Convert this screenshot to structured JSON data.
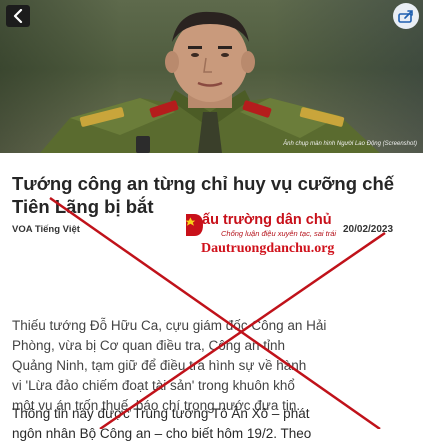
{
  "hero": {
    "caption": "Ảnh chụp màn hình Người Lao Động (Screenshot)"
  },
  "header": {
    "back_icon": "chevron-left-icon",
    "share_icon": "share-icon"
  },
  "article": {
    "headline_line1": "Tướng công an từng chỉ huy vụ cưỡng chế",
    "headline_line2": "Tiên Lãng bị bắt",
    "source": "VOA Tiếng Việt",
    "date": "20/02/2023",
    "para1_lines": [
      "Thiếu tướng Đỗ Hữu Ca, cựu giám đốc Công an Hải",
      "Phòng, vừa bị Cơ quan điều tra, Công an tỉnh",
      "Quảng Ninh, tạm giữ để điều tra hình sự về hành",
      "vi 'Lừa đảo chiếm đoạt tài sản' trong khuôn khổ",
      "một vụ án trốn thuế, báo chí trong nước đưa tin."
    ],
    "para2_lines": [
      "Thông tin này được Trung tướng Tô Ân Xô – phát",
      "ngôn nhân Bộ Công an – cho biết hôm 19/2. Theo"
    ]
  },
  "watermark": {
    "title": "ấu trường dân chủ",
    "subtitle": "Chống luận điệu xuyên tạc, sai trái",
    "url": "Dautruongdanchu.org"
  },
  "colors": {
    "headline": "#262626",
    "watermark_red": "#c8101a",
    "cross_red": "#c0121a",
    "uniform_green": "#5a6b2f"
  }
}
